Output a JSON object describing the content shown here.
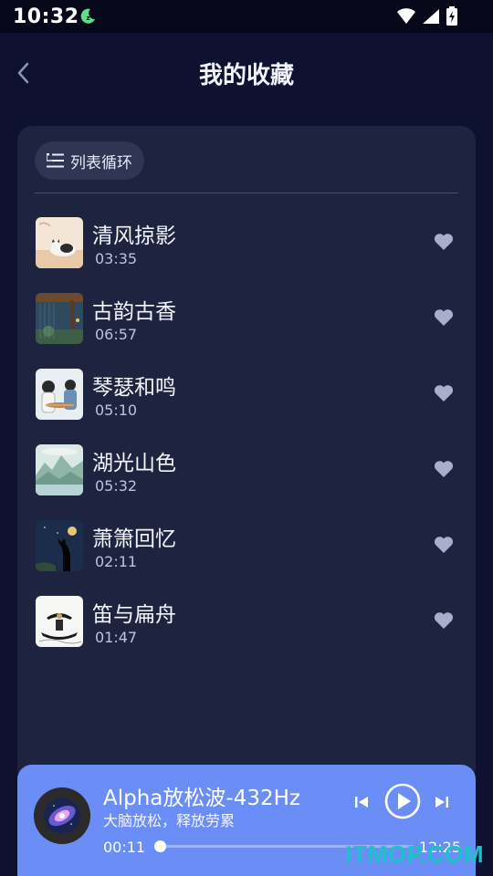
{
  "status_bar": {
    "time": "10:32"
  },
  "header": {
    "title": "我的收藏",
    "back_icon": "chevron-left-icon"
  },
  "playlist": {
    "loop_mode_label": "列表循环",
    "loop_icon": "list-loop-icon",
    "songs": [
      {
        "title": "清风掠影",
        "duration": "03:35",
        "thumb": "cat-on-cushion"
      },
      {
        "title": "古韵古香",
        "duration": "06:57",
        "thumb": "rainy-pavilion"
      },
      {
        "title": "琴瑟和鸣",
        "duration": "05:10",
        "thumb": "musicians-playing"
      },
      {
        "title": "湖光山色",
        "duration": "05:32",
        "thumb": "misty-lake-mountains"
      },
      {
        "title": "萧箫回忆",
        "duration": "02:11",
        "thumb": "night-cat-silhouette"
      },
      {
        "title": "笛与扁舟",
        "duration": "01:47",
        "thumb": "boat-ink-painting"
      }
    ]
  },
  "player": {
    "title": "Alpha放松波-432Hz",
    "subtitle": "大脑放松，释放劳累",
    "current_time": "00:11",
    "total_time": "12:25",
    "progress": 0.015,
    "colors": {
      "background": "#6a8ef5"
    }
  },
  "watermark": "ITMOP.COM"
}
